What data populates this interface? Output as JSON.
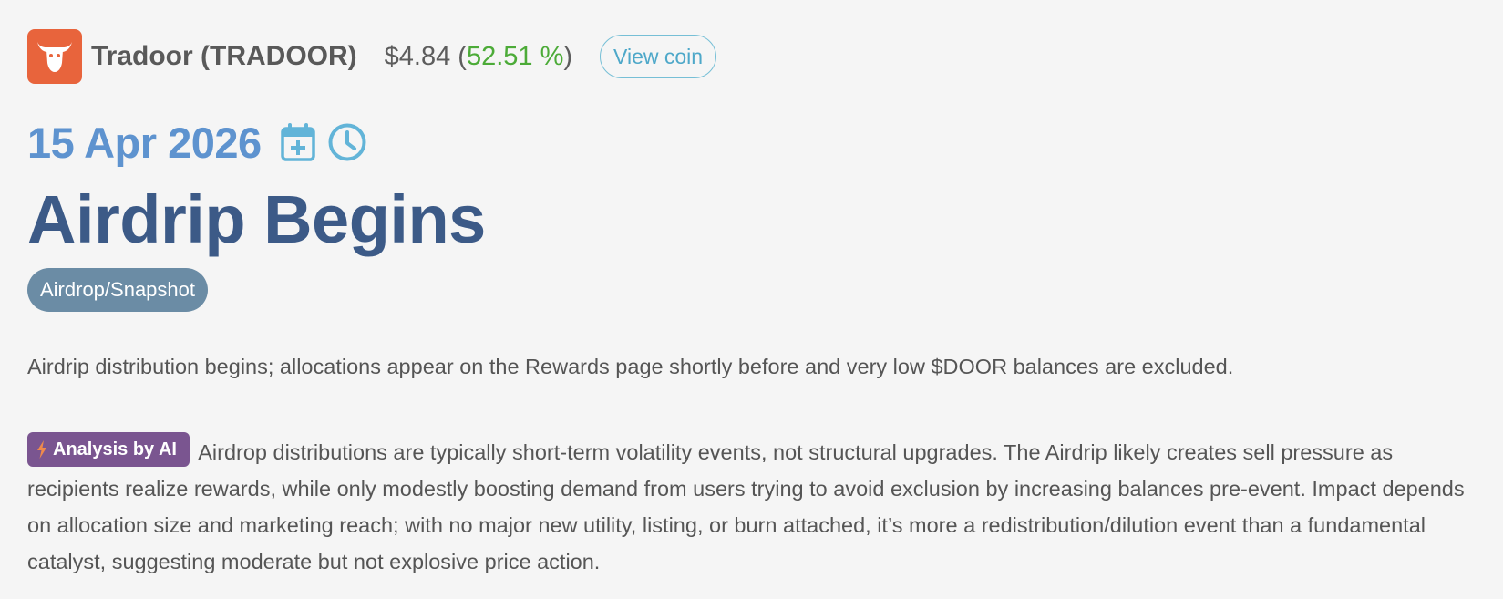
{
  "coin": {
    "name": "Tradoor (TRADOOR)",
    "price": "$4.84",
    "change": "52.51 %",
    "view_label": "View coin",
    "logo_icon": "bull-head-icon",
    "logo_color": "#e8643c"
  },
  "event": {
    "date": "15 Apr 2026",
    "title": "Airdrip Begins",
    "category": "Airdrop/Snapshot",
    "description": "Airdrip distribution begins; allocations appear on the Rewards page shortly before and very low $DOOR balances are excluded."
  },
  "analysis": {
    "badge_label": "Analysis by AI",
    "text": "Airdrop distributions are typically short-term volatility events, not structural upgrades. The Airdrip likely creates sell pressure as recipients realize rewards, while only modestly boosting demand from users trying to avoid exclusion by increasing balances pre-event. Impact depends on allocation size and marketing reach; with no major new utility, listing, or burn attached, it’s more a redistribution/dilution event than a fundamental catalyst, suggesting moderate but not explosive price action."
  },
  "icons": {
    "calendar": "calendar-add-icon",
    "clock": "clock-icon",
    "bolt": "lightning-bolt-icon"
  },
  "colors": {
    "date": "#5e93cf",
    "title": "#3c5a87",
    "positive_change": "#4cab38",
    "category_pill": "#6b8ca5",
    "ai_badge": "#7a5590",
    "view_button": "#4ea8c9"
  }
}
